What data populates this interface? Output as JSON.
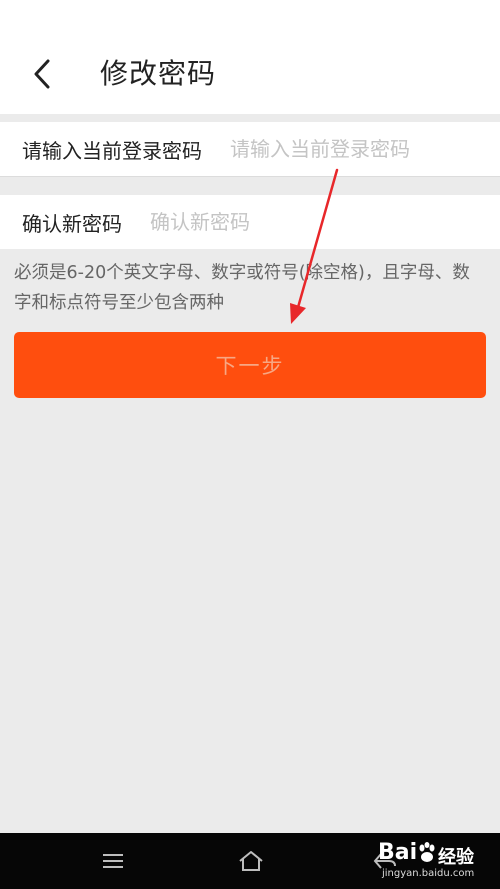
{
  "header": {
    "title": "修改密码",
    "back_icon": "chevron-left-icon"
  },
  "form": {
    "current_password": {
      "label": "请输入当前登录密码",
      "placeholder": "请输入当前登录密码",
      "value": ""
    },
    "new_password": {
      "label": "确认新密码",
      "placeholder": "确认新密码",
      "value": ""
    },
    "hint": "必须是6-20个英文字母、数字或符号(除空格)，且字母、数字和标点符号至少包含两种",
    "next_label": "下一步"
  },
  "navbar": {
    "menu_icon": "menu-icon",
    "home_icon": "home-icon",
    "back_icon": "back-icon"
  },
  "watermark": {
    "brand": "Bai",
    "brand_cn": "经验",
    "url": "jingyan.baidu.com"
  },
  "colors": {
    "accent": "#ff4e0e",
    "button_text": "#f7a784",
    "annotation": "#e8272a",
    "background": "#ebebeb",
    "navbar": "#060606"
  }
}
